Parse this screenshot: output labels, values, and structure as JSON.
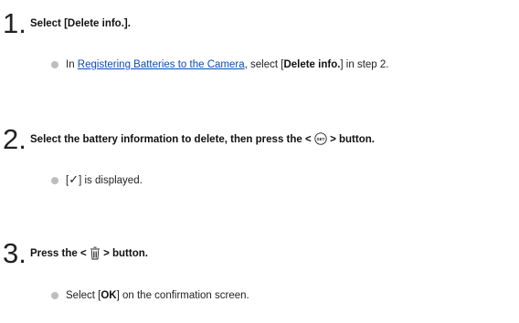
{
  "steps": [
    {
      "number": "1.",
      "title": "Select [Delete info.].",
      "bullet": {
        "prefix": "In ",
        "link": "Registering Batteries to the Camera",
        "mid": ", select [",
        "bold": "Delete info.",
        "suffix": "] in step 2."
      }
    },
    {
      "number": "2.",
      "title_before": "Select the battery information to delete, then press the < ",
      "title_after": " > button.",
      "icon": "set-button-icon",
      "bullet": {
        "open": "[",
        "check": "✓",
        "close": "] is displayed."
      }
    },
    {
      "number": "3.",
      "title_before": "Press the < ",
      "title_after": " > button.",
      "icon": "erase-trash-icon",
      "bullet": {
        "prefix": "Select [",
        "bold": "OK",
        "suffix": "] on the confirmation screen."
      }
    }
  ]
}
